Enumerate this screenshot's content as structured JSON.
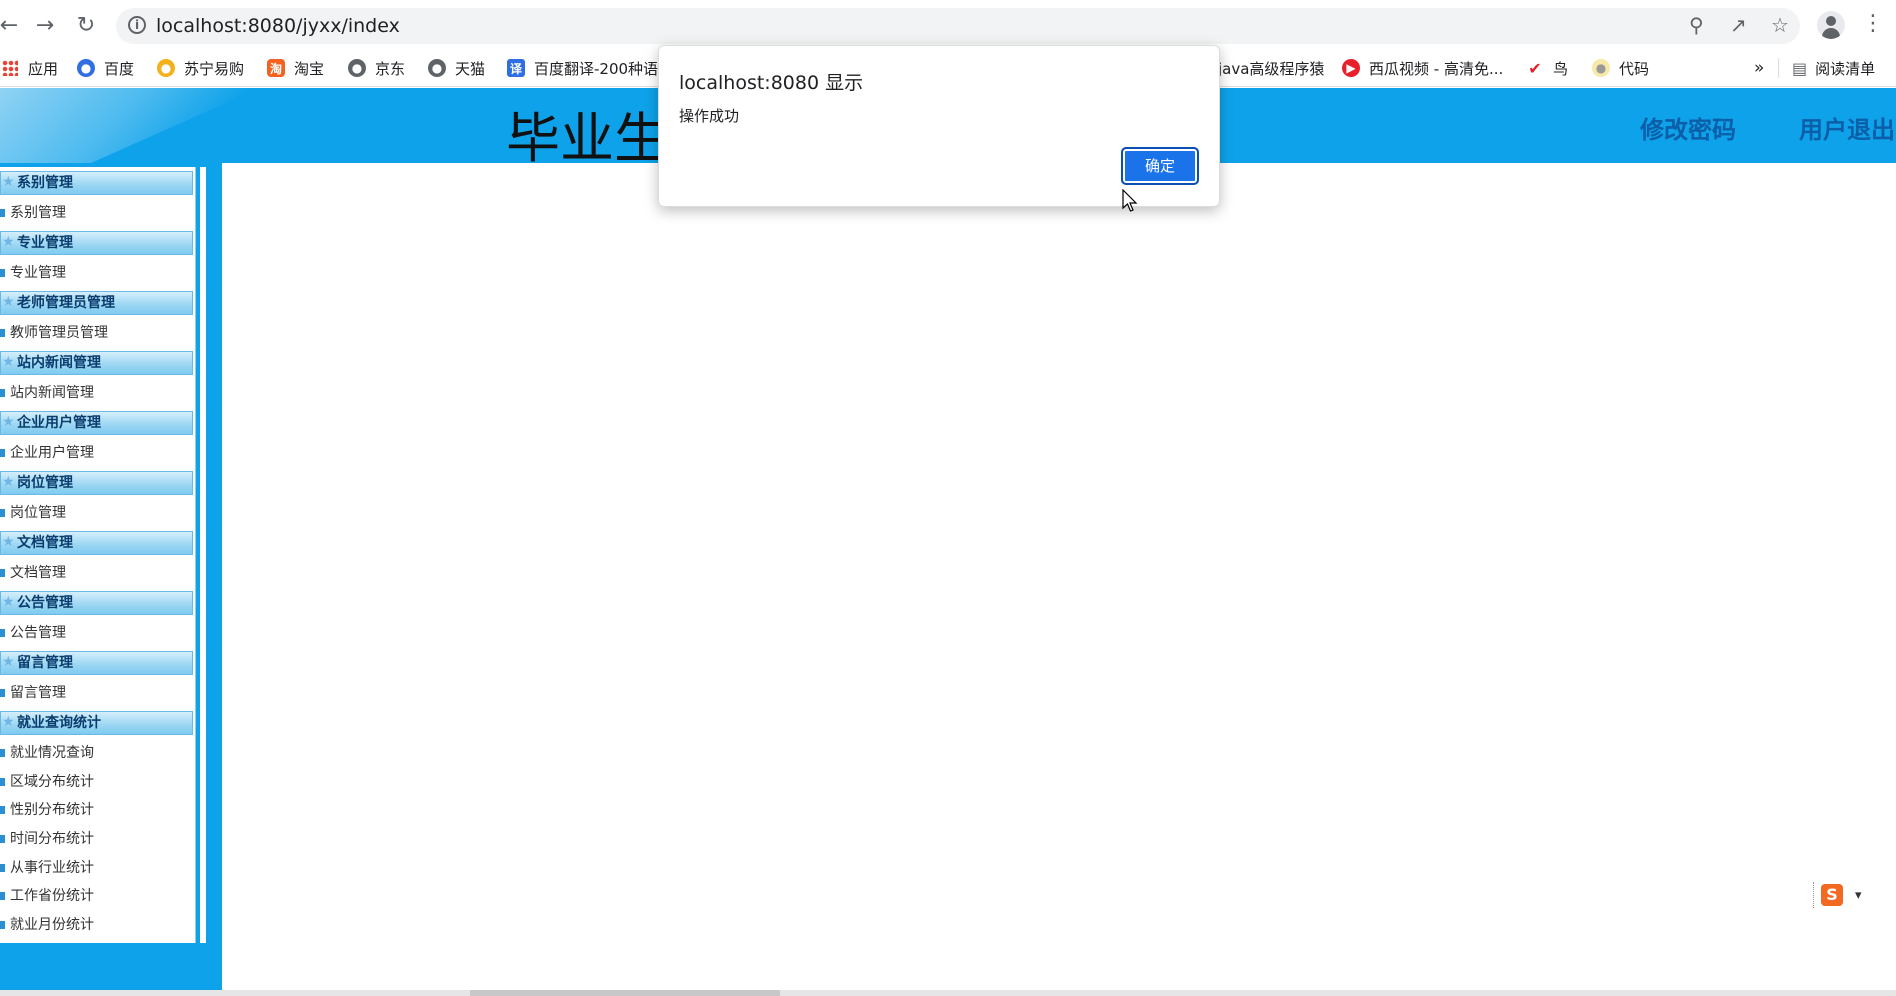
{
  "browser": {
    "url": "localhost:8080/jyxx/index",
    "bookmarks": [
      {
        "label": "应用",
        "icon": "apps-grid-icon"
      },
      {
        "label": "百度",
        "icon": "baidu-icon"
      },
      {
        "label": "苏宁易购",
        "icon": "suning-icon"
      },
      {
        "label": "淘宝",
        "icon": "taobao-icon"
      },
      {
        "label": "京东",
        "icon": "globe-icon"
      },
      {
        "label": "天猫",
        "icon": "globe-icon"
      },
      {
        "label": "百度翻译-200种语",
        "icon": "translate-icon"
      },
      {
        "label": "java高级程序猿",
        "icon": "bookmark-icon"
      },
      {
        "label": "西瓜视频 - 高清免...",
        "icon": "xigua-icon"
      },
      {
        "label": "鸟",
        "icon": "bird-icon"
      },
      {
        "label": "代码",
        "icon": "code-icon"
      }
    ],
    "overflow_label": "»",
    "reading_list_label": "阅读清单"
  },
  "header": {
    "title": "毕业生",
    "change_password": "修改密码",
    "logout": "用户退出"
  },
  "sidebar": {
    "groups": [
      {
        "title": "系别管理",
        "items": [
          "系别管理"
        ]
      },
      {
        "title": "专业管理",
        "items": [
          "专业管理"
        ]
      },
      {
        "title": "老师管理员管理",
        "items": [
          "教师管理员管理"
        ]
      },
      {
        "title": "站内新闻管理",
        "items": [
          "站内新闻管理"
        ]
      },
      {
        "title": "企业用户管理",
        "items": [
          "企业用户管理"
        ]
      },
      {
        "title": "岗位管理",
        "items": [
          "岗位管理"
        ]
      },
      {
        "title": "文档管理",
        "items": [
          "文档管理"
        ]
      },
      {
        "title": "公告管理",
        "items": [
          "公告管理"
        ]
      },
      {
        "title": "留言管理",
        "items": [
          "留言管理"
        ]
      },
      {
        "title": "就业查询统计",
        "items": [
          "就业情况查询",
          "区域分布统计",
          "性别分布统计",
          "时间分布统计",
          "从事行业统计",
          "工作省份统计",
          "就业月份统计"
        ]
      }
    ]
  },
  "dialog": {
    "title": "localhost:8080 显示",
    "message": "操作成功",
    "ok_label": "确定"
  },
  "ime": {
    "label": "S"
  },
  "colors": {
    "header_blue": "#0ea2ea",
    "link_blue": "#0b5ea8",
    "dialog_button": "#1a73e8"
  }
}
